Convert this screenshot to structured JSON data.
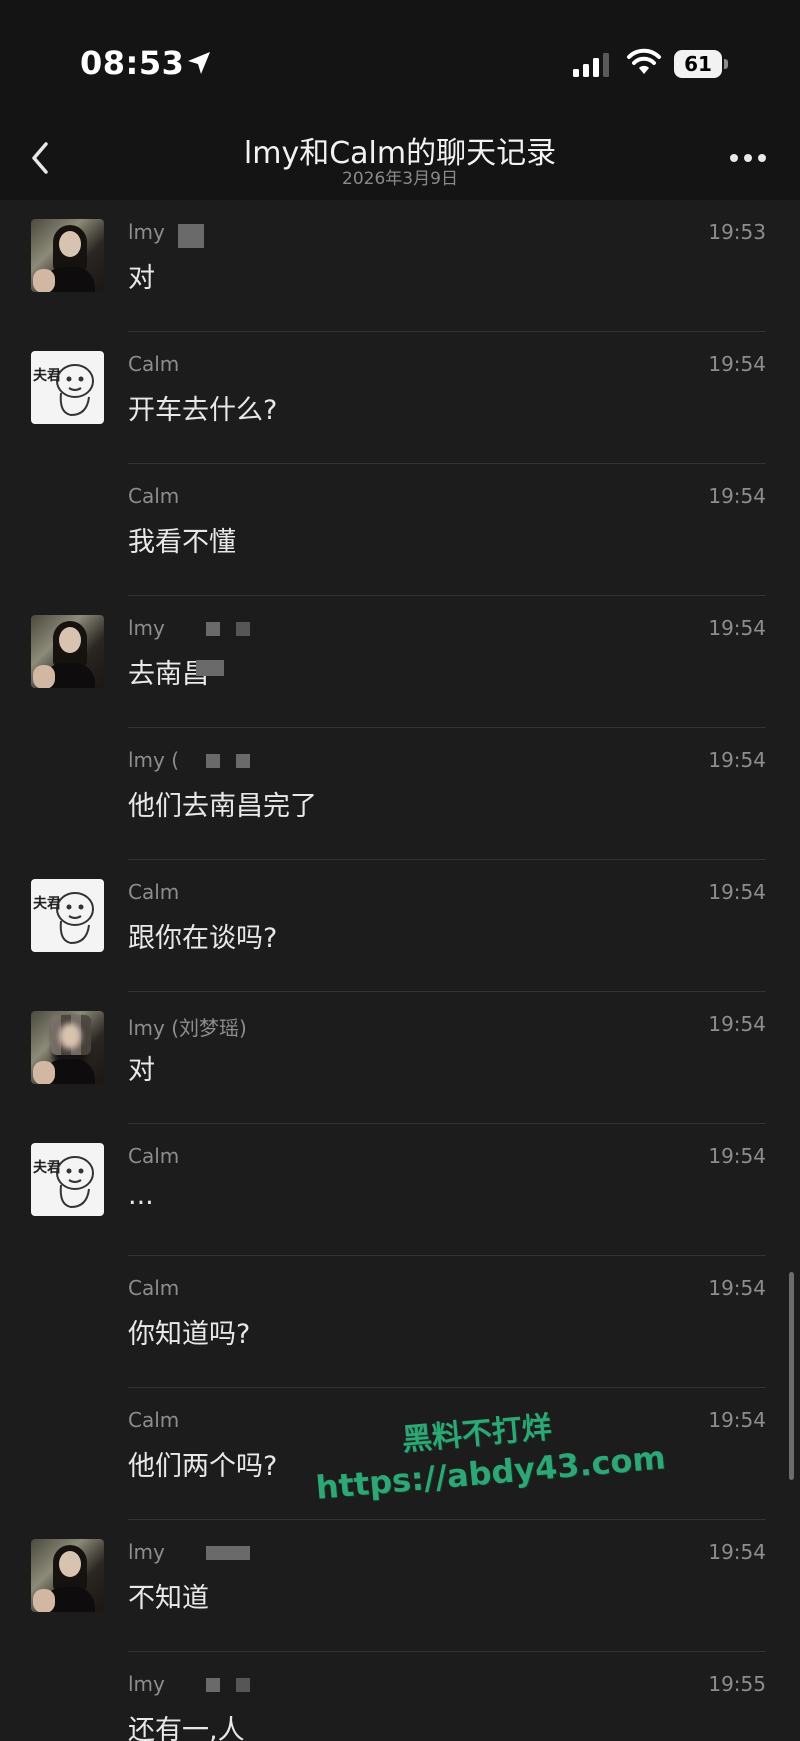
{
  "status_bar": {
    "time": "08:53",
    "battery_percent": "61"
  },
  "nav": {
    "title": "lmy和Calm的聊天记录",
    "subtitle": "2026年3月9日"
  },
  "messages": [
    {
      "sender": "lmy",
      "time": "19:53",
      "text": "对",
      "avatar": "photo"
    },
    {
      "sender": "Calm",
      "time": "19:54",
      "text": "开车去什么?",
      "avatar": "sticker"
    },
    {
      "sender": "Calm",
      "time": "19:54",
      "text": "我看不懂",
      "avatar": "none"
    },
    {
      "sender": "lmy",
      "time": "19:54",
      "text": "去南昌",
      "avatar": "photo"
    },
    {
      "sender": "lmy (",
      "time": "19:54",
      "text": "他们去南昌完了",
      "avatar": "none"
    },
    {
      "sender": "Calm",
      "time": "19:54",
      "text": "跟你在谈吗?",
      "avatar": "sticker"
    },
    {
      "sender": "lmy (刘梦瑶)",
      "time": "19:54",
      "text": "对",
      "avatar": "photo-blur"
    },
    {
      "sender": "Calm",
      "time": "19:54",
      "text": "...",
      "avatar": "sticker"
    },
    {
      "sender": "Calm",
      "time": "19:54",
      "text": "你知道吗?",
      "avatar": "none"
    },
    {
      "sender": "Calm",
      "time": "19:54",
      "text": "他们两个吗?",
      "avatar": "none"
    },
    {
      "sender": "lmy",
      "time": "19:54",
      "text": "不知道",
      "avatar": "photo"
    },
    {
      "sender": "lmy",
      "time": "19:55",
      "text": "还有一,人",
      "avatar": "none"
    }
  ],
  "sticker_tag": "夫君",
  "watermark": {
    "line1": "黑料不打烊",
    "line2": "https://abdy43.com"
  },
  "icons": {
    "location": "location-arrow-icon",
    "signal": "cellular-signal-icon",
    "wifi": "wifi-icon",
    "back": "chevron-left-icon",
    "more": "more-dots-icon"
  }
}
